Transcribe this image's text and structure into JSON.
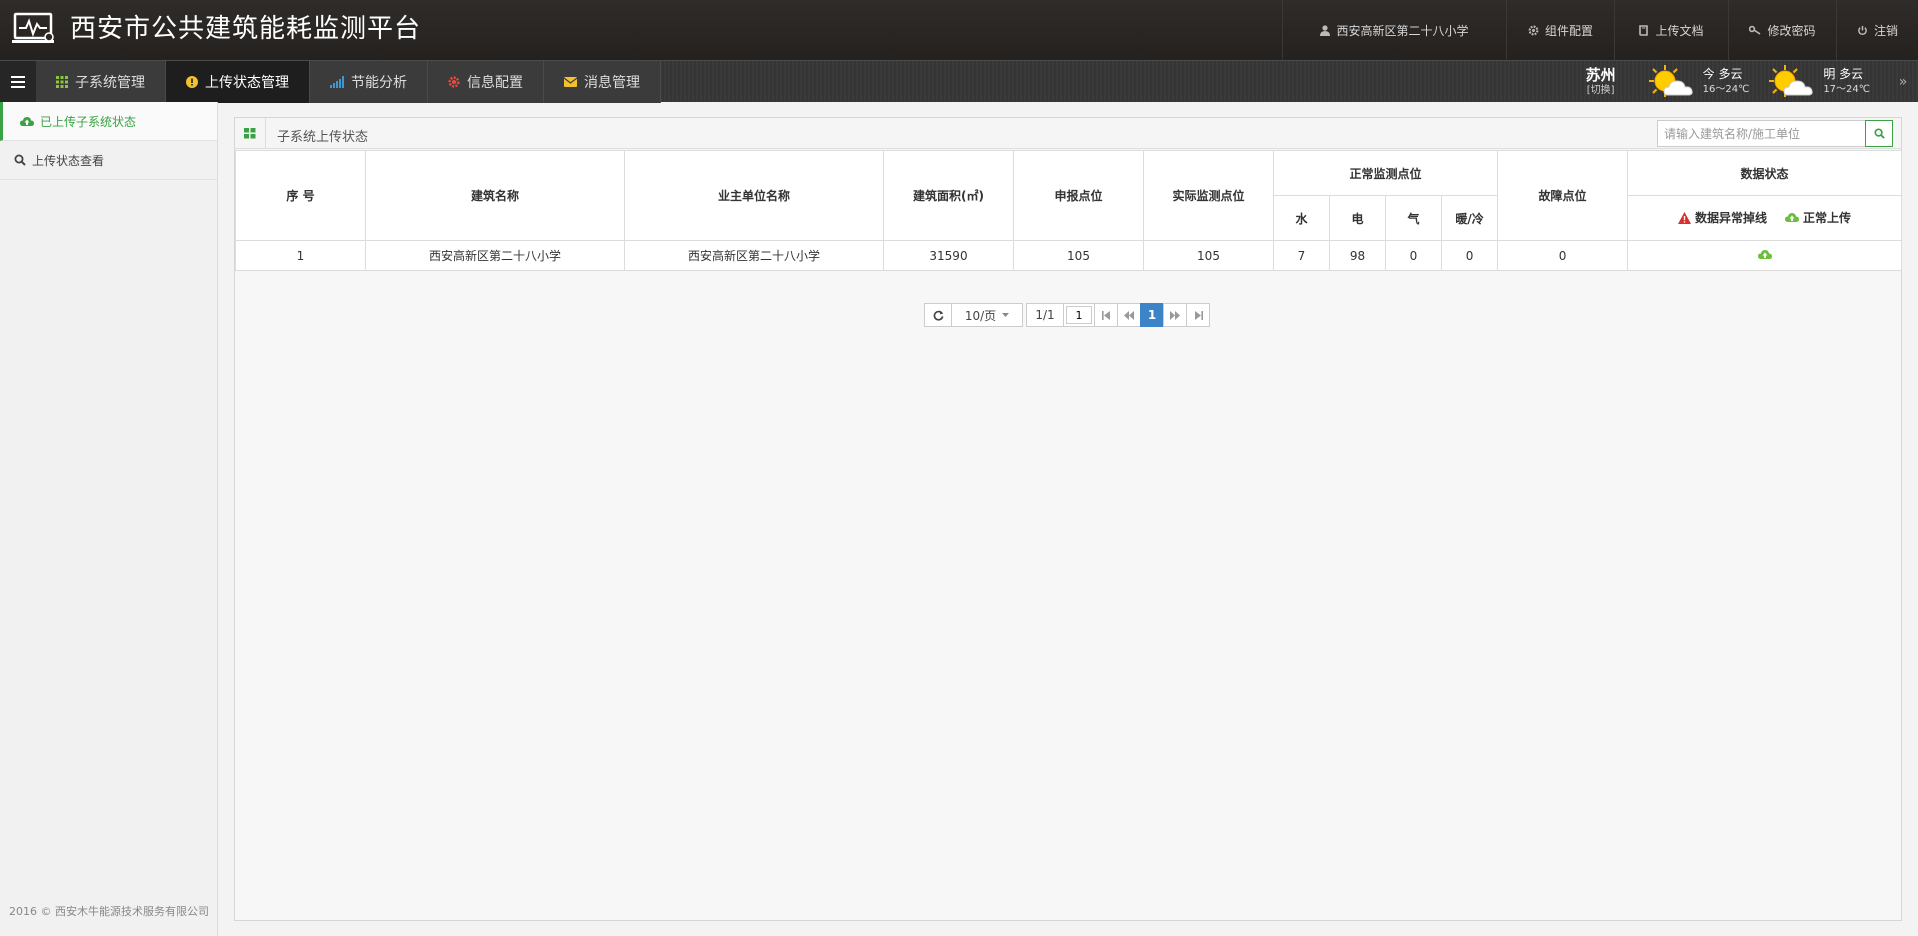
{
  "header": {
    "title": "西安市公共建筑能耗监测平台",
    "user": "西安高新区第二十八小学",
    "component_config": "组件配置",
    "upload_doc": "上传文档",
    "change_password": "修改密码",
    "logout": "注销"
  },
  "menu": {
    "tabs": [
      {
        "label": "子系统管理",
        "icon": "grid-icon",
        "color": "#8cc63f"
      },
      {
        "label": "上传状态管理",
        "icon": "alert-circle-icon",
        "color": "#f2c12e",
        "active": true
      },
      {
        "label": "节能分析",
        "icon": "signal-bars-icon",
        "color": "#3a9ad9"
      },
      {
        "label": "信息配置",
        "icon": "gear-icon",
        "color": "#e94b3c"
      },
      {
        "label": "消息管理",
        "icon": "envelope-icon",
        "color": "#f2c12e"
      }
    ]
  },
  "weather": {
    "city": "苏州",
    "switch": "[切换]",
    "today_label": "今 多云",
    "today_temp": "16～24℃",
    "tomorrow_label": "明 多云",
    "tomorrow_temp": "17～24℃",
    "more": "»"
  },
  "sidebar": {
    "items": [
      {
        "label": "已上传子系统状态",
        "icon": "cloud-upload-icon",
        "active": true
      },
      {
        "label": "上传状态查看",
        "icon": "search-icon"
      }
    ],
    "copyright": "2016 © 西安木牛能源技术服务有限公司"
  },
  "panel": {
    "title": "子系统上传状态",
    "search_placeholder": "请输入建筑名称/施工单位"
  },
  "table": {
    "headers": {
      "index": "序 号",
      "building": "建筑名称",
      "owner": "业主单位名称",
      "area": "建筑面积(㎡)",
      "reported": "申报点位",
      "actual": "实际监测点位",
      "normal": "正常监测点位",
      "water": "水",
      "electric": "电",
      "gas": "气",
      "heat": "暖/冷",
      "fault": "故障点位",
      "status": "数据状态",
      "status_abnormal": "数据异常掉线",
      "status_normal": "正常上传"
    },
    "rows": [
      {
        "index": "1",
        "building": "西安高新区第二十八小学",
        "owner": "西安高新区第二十八小学",
        "area": "31590",
        "reported": "105",
        "actual": "105",
        "water": "7",
        "electric": "98",
        "gas": "0",
        "heat": "0",
        "fault": "0",
        "status_icon": "cloud-upload-icon"
      }
    ]
  },
  "pager": {
    "page_size": "10/页",
    "page_count": "1/1",
    "page_input": "1",
    "current": "1"
  },
  "colors": {
    "accent_green": "#3aa245",
    "warn_red": "#d9302c",
    "ok_green": "#6bbf3d",
    "page_blue": "#3d83c7"
  }
}
